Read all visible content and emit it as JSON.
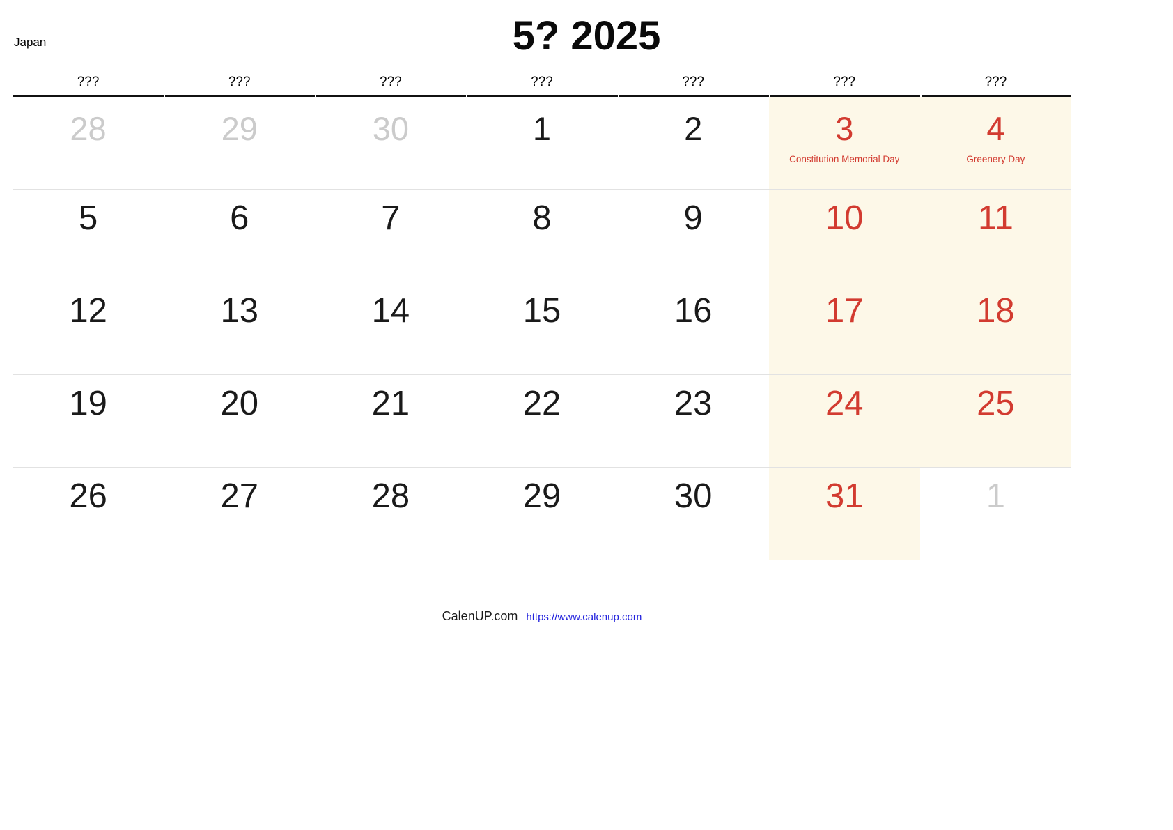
{
  "header": {
    "country": "Japan",
    "title": "5? 2025"
  },
  "weekdays": [
    "???",
    "???",
    "???",
    "???",
    "???",
    "???",
    "???"
  ],
  "colors": {
    "weekend_background": "#FDF8E8",
    "holiday_red": "#D23B30",
    "muted_grey": "#CBCBCB",
    "rule_black": "#111111",
    "link_blue": "#2222DD"
  },
  "weeks": [
    [
      {
        "num": "28",
        "state": "muted",
        "highlight": false,
        "holiday": ""
      },
      {
        "num": "29",
        "state": "muted",
        "highlight": false,
        "holiday": ""
      },
      {
        "num": "30",
        "state": "muted",
        "highlight": false,
        "holiday": ""
      },
      {
        "num": "1",
        "state": "normal",
        "highlight": false,
        "holiday": ""
      },
      {
        "num": "2",
        "state": "normal",
        "highlight": false,
        "holiday": ""
      },
      {
        "num": "3",
        "state": "red",
        "highlight": true,
        "holiday": "Constitution Memorial Day"
      },
      {
        "num": "4",
        "state": "red",
        "highlight": true,
        "holiday": "Greenery Day"
      }
    ],
    [
      {
        "num": "5",
        "state": "normal",
        "highlight": false,
        "holiday": ""
      },
      {
        "num": "6",
        "state": "normal",
        "highlight": false,
        "holiday": ""
      },
      {
        "num": "7",
        "state": "normal",
        "highlight": false,
        "holiday": ""
      },
      {
        "num": "8",
        "state": "normal",
        "highlight": false,
        "holiday": ""
      },
      {
        "num": "9",
        "state": "normal",
        "highlight": false,
        "holiday": ""
      },
      {
        "num": "10",
        "state": "red",
        "highlight": true,
        "holiday": ""
      },
      {
        "num": "11",
        "state": "red",
        "highlight": true,
        "holiday": ""
      }
    ],
    [
      {
        "num": "12",
        "state": "normal",
        "highlight": false,
        "holiday": ""
      },
      {
        "num": "13",
        "state": "normal",
        "highlight": false,
        "holiday": ""
      },
      {
        "num": "14",
        "state": "normal",
        "highlight": false,
        "holiday": ""
      },
      {
        "num": "15",
        "state": "normal",
        "highlight": false,
        "holiday": ""
      },
      {
        "num": "16",
        "state": "normal",
        "highlight": false,
        "holiday": ""
      },
      {
        "num": "17",
        "state": "red",
        "highlight": true,
        "holiday": ""
      },
      {
        "num": "18",
        "state": "red",
        "highlight": true,
        "holiday": ""
      }
    ],
    [
      {
        "num": "19",
        "state": "normal",
        "highlight": false,
        "holiday": ""
      },
      {
        "num": "20",
        "state": "normal",
        "highlight": false,
        "holiday": ""
      },
      {
        "num": "21",
        "state": "normal",
        "highlight": false,
        "holiday": ""
      },
      {
        "num": "22",
        "state": "normal",
        "highlight": false,
        "holiday": ""
      },
      {
        "num": "23",
        "state": "normal",
        "highlight": false,
        "holiday": ""
      },
      {
        "num": "24",
        "state": "red",
        "highlight": true,
        "holiday": ""
      },
      {
        "num": "25",
        "state": "red",
        "highlight": true,
        "holiday": ""
      }
    ],
    [
      {
        "num": "26",
        "state": "normal",
        "highlight": false,
        "holiday": ""
      },
      {
        "num": "27",
        "state": "normal",
        "highlight": false,
        "holiday": ""
      },
      {
        "num": "28",
        "state": "normal",
        "highlight": false,
        "holiday": ""
      },
      {
        "num": "29",
        "state": "normal",
        "highlight": false,
        "holiday": ""
      },
      {
        "num": "30",
        "state": "normal",
        "highlight": false,
        "holiday": ""
      },
      {
        "num": "31",
        "state": "red",
        "highlight": true,
        "holiday": ""
      },
      {
        "num": "1",
        "state": "muted",
        "highlight": false,
        "holiday": ""
      }
    ]
  ],
  "footer": {
    "brand": "CalenUP.com",
    "url": "https://www.calenup.com"
  }
}
